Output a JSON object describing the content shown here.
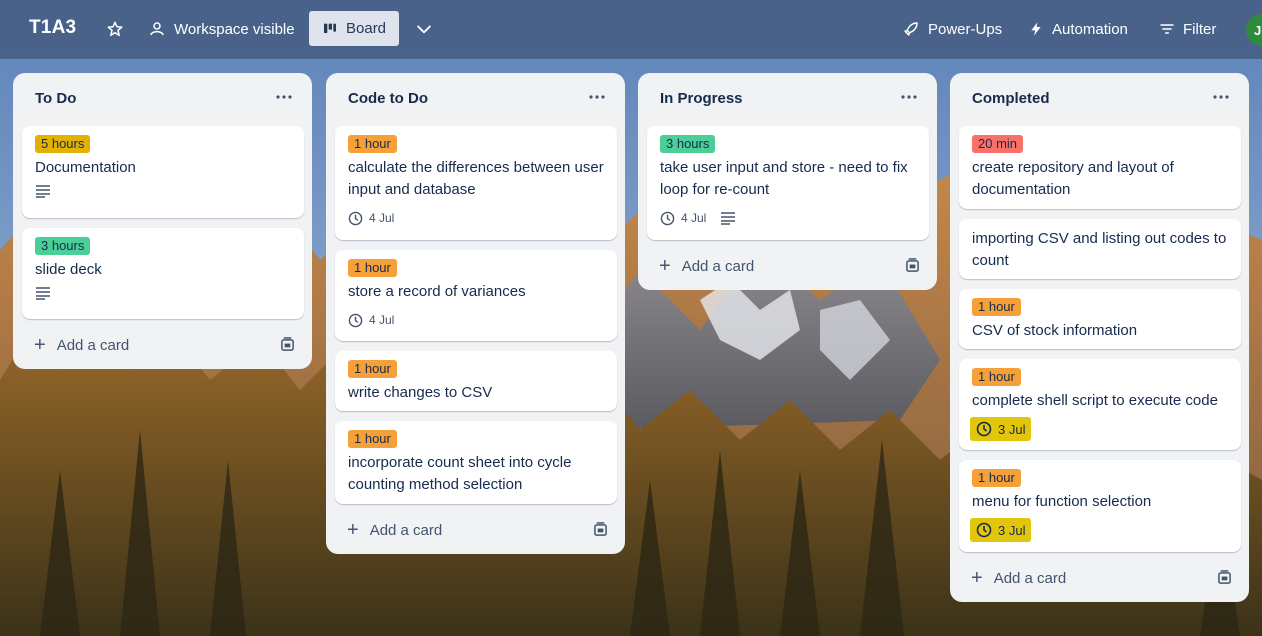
{
  "board": {
    "title": "T1A3",
    "workspace_visibility": "Workspace visible",
    "view_label": "Board"
  },
  "toolbar": {
    "powerups_label": "Power-Ups",
    "automation_label": "Automation",
    "filter_label": "Filter",
    "avatar_initial": "J"
  },
  "lists": [
    {
      "title": "To Do",
      "add_label": "Add a card",
      "cards": [
        {
          "label": "5 hours",
          "label_color": "#e2b203",
          "title": "Documentation",
          "date": "",
          "has_description": true
        },
        {
          "label": "3 hours",
          "label_color": "#4bce97",
          "title": "slide deck",
          "date": "",
          "has_description": true
        }
      ]
    },
    {
      "title": "Code to Do",
      "add_label": "Add a card",
      "cards": [
        {
          "label": "1 hour",
          "label_color": "#f5a038",
          "title": "calculate the differences between user input and database",
          "date": "4 Jul",
          "has_description": false
        },
        {
          "label": "1 hour",
          "label_color": "#f5a038",
          "title": "store a record of variances",
          "date": "4 Jul",
          "has_description": false
        },
        {
          "label": "1 hour",
          "label_color": "#f5a038",
          "title": "write changes to CSV",
          "date": "",
          "has_description": false
        },
        {
          "label": "1 hour",
          "label_color": "#f5a038",
          "title": "incorporate count sheet into cycle counting method selection",
          "date": "",
          "has_description": false
        }
      ]
    },
    {
      "title": "In Progress",
      "add_label": "Add a card",
      "cards": [
        {
          "label": "3 hours",
          "label_color": "#4bce97",
          "title": "take user input and store - need to fix loop for re-count",
          "date": "4 Jul",
          "has_description": true
        }
      ]
    },
    {
      "title": "Completed",
      "add_label": "Add a card",
      "cards": [
        {
          "label": "20 min",
          "label_color": "#f87168",
          "title": "create repository and layout of documentation",
          "date": "",
          "has_description": false
        },
        {
          "label": "",
          "label_color": "",
          "title": "importing CSV and listing out codes to count",
          "date": "",
          "has_description": false
        },
        {
          "label": "1 hour",
          "label_color": "#f5a038",
          "title": "CSV of stock information",
          "date": "",
          "has_description": false
        },
        {
          "label": "1 hour",
          "label_color": "#f5a038",
          "title": "complete shell script to execute code",
          "date": "3 Jul",
          "date_due": true,
          "has_description": false
        },
        {
          "label": "1 hour",
          "label_color": "#f5a038",
          "title": "menu for function selection",
          "date": "3 Jul",
          "date_due": true,
          "has_description": false
        }
      ]
    }
  ],
  "icons": {
    "star": "star-icon",
    "workspace": "people-icon",
    "board_view": "board-icon",
    "chevron": "chevron-down-icon",
    "powerups": "rocket-icon",
    "automation": "lightning-icon",
    "filter": "filter-icon",
    "list_menu": "more-icon",
    "clock": "clock-icon",
    "description": "description-icon",
    "template": "template-icon"
  }
}
